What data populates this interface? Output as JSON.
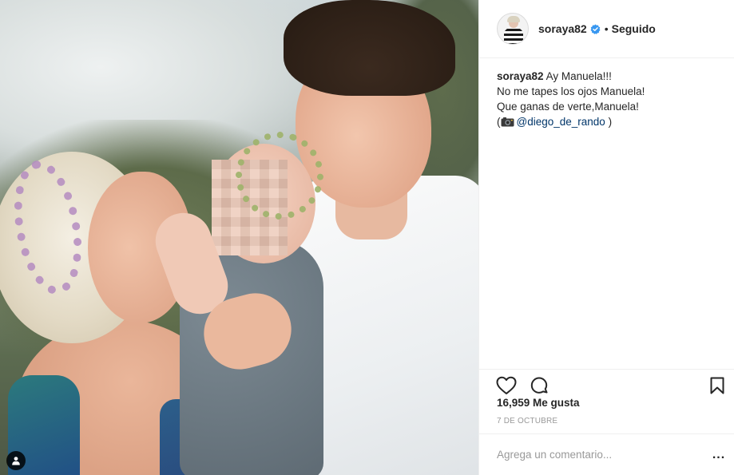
{
  "post": {
    "username": "soraya82",
    "follow_status": "Seguido",
    "header_separator": "•",
    "caption": {
      "username": "soraya82",
      "lines": [
        "Ay Manuela!!!",
        "No me tapes los ojos Manuela!",
        "Que ganas de verte,Manuela!"
      ],
      "credit_open": "(",
      "credit_mention": "@diego_de_rando",
      "credit_close": ")"
    },
    "likes": "16,959 Me gusta",
    "date": "7 de octubre",
    "comment_placeholder": "Agrega un comentario...",
    "more_label": "..."
  },
  "icons": {
    "verified": "verified-badge-icon",
    "like": "heart-icon",
    "comment": "comment-icon",
    "save": "bookmark-icon",
    "tag": "user-tag-icon",
    "camera": "camera-emoji-icon"
  },
  "colors": {
    "text": "#262626",
    "muted": "#999999",
    "verified": "#3897f0",
    "mention": "#003569",
    "divider": "#efefef"
  }
}
